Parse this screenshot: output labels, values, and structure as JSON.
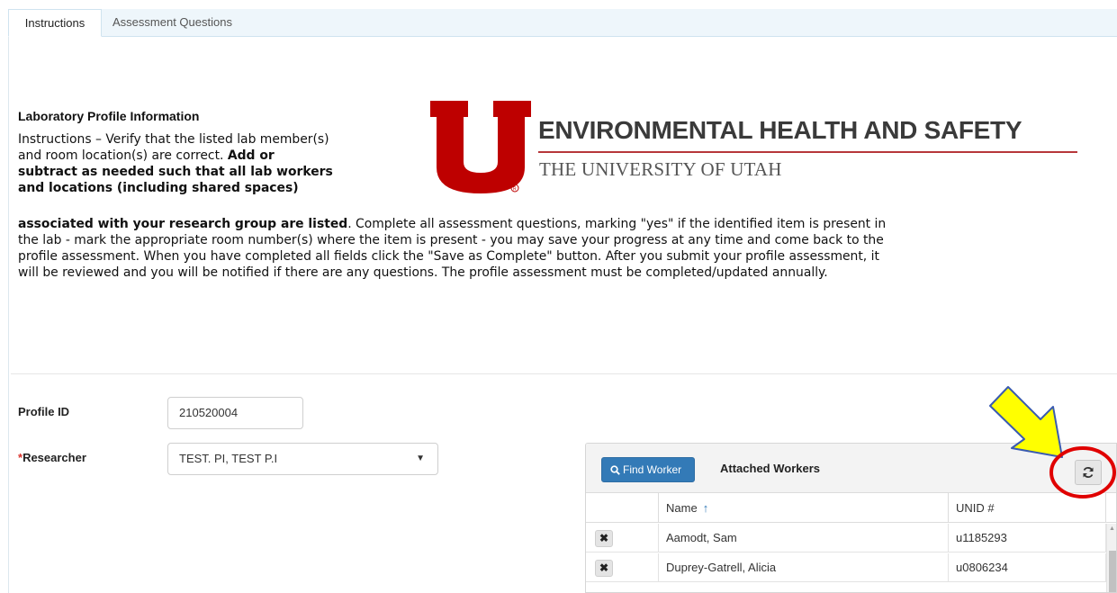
{
  "tabs": [
    {
      "label": "Instructions",
      "active": true
    },
    {
      "label": "Assessment Questions",
      "active": false
    }
  ],
  "section_title": "Laboratory Profile Information",
  "instructions": {
    "l1": "Instructions – Verify that the listed lab member(s)",
    "l2a": "and room location(s) are correct.  ",
    "l2b": "Add or",
    "l3": "subtract as needed such that all lab workers",
    "l4": "and locations (including shared spaces)",
    "l5a": "associated with your research group are listed",
    "l5b": ".  Complete all assessment questions, marking \"yes\" if the identified item is present in",
    "l6": "the lab - mark the appropriate room number(s) where the item is present - you may save your progress at any time and come back to the",
    "l7": "profile assessment.  When you have completed all fields click the \"Save as Complete\" button.  After you submit your profile assessment, it",
    "l8": "will be reviewed and you will be notified if there are any questions.  The profile assessment must be completed/updated annually."
  },
  "logo": {
    "title": "ENVIRONMENTAL HEALTH AND SAFETY",
    "subtitle": "THE UNIVERSITY OF UTAH",
    "brand_color": "#be0000"
  },
  "form": {
    "profile_id_label": "Profile ID",
    "profile_id_value": "210520004",
    "researcher_required_mark": "*",
    "researcher_label": "Researcher",
    "researcher_value": "TEST. PI, TEST P.I"
  },
  "workers_panel": {
    "find_button": "Find Worker",
    "title": "Attached Workers",
    "columns": [
      "Name",
      "UNID #"
    ],
    "sort_indicator": "↑",
    "rows": [
      {
        "name": "Aamodt, Sam",
        "unid": "u1185293"
      },
      {
        "name": "Duprey-Gatrell, Alicia",
        "unid": "u0806234"
      }
    ],
    "remove_glyph": "✖"
  },
  "colors": {
    "accent": "#337ab7",
    "annotation_arrow": "#ffff00",
    "annotation_circle": "#e00000"
  }
}
